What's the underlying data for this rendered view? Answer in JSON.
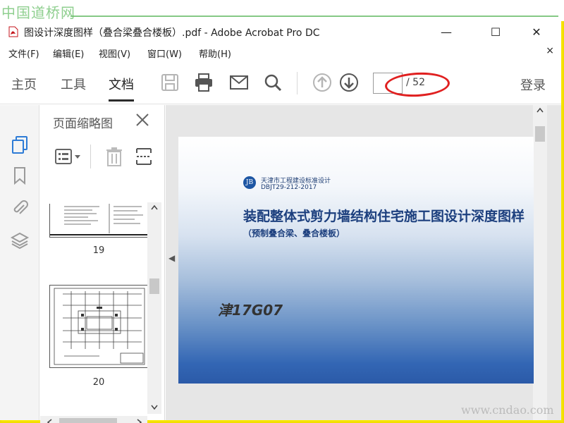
{
  "watermark": {
    "top_text": "中国道桥网",
    "bottom_text": "www.cndao.com"
  },
  "window": {
    "title": "图设计深度图样（叠合梁叠合楼板）.pdf - Adobe Acrobat Pro DC",
    "controls": {
      "minimize": "—",
      "maximize": "☐",
      "close": "✕"
    }
  },
  "menu": {
    "items": [
      "文件(F)",
      "编辑(E)",
      "视图(V)",
      "窗口(W)",
      "帮助(H)"
    ],
    "close_label": "×"
  },
  "toolbar": {
    "tabs": [
      "主页",
      "工具",
      "文档"
    ],
    "active_tab": "文档",
    "page_current": "",
    "page_total": "/ 52",
    "login_label": "登录"
  },
  "thumbnails": {
    "panel_title": "页面缩略图",
    "pages": [
      "19",
      "20"
    ]
  },
  "document": {
    "org": "天津市工程建设标准设计",
    "code": "DBJT29-212-2017",
    "title": "装配整体式剪力墙结构住宅施工图设计深度图样",
    "subtitle": "（预制叠合梁、叠合楼板）",
    "series": "津17G07",
    "logo_text": "JB"
  },
  "colors": {
    "accent_ring": "#e02020",
    "page_gradient_bottom": "#2b5aa8",
    "frame": "#f7e600"
  }
}
